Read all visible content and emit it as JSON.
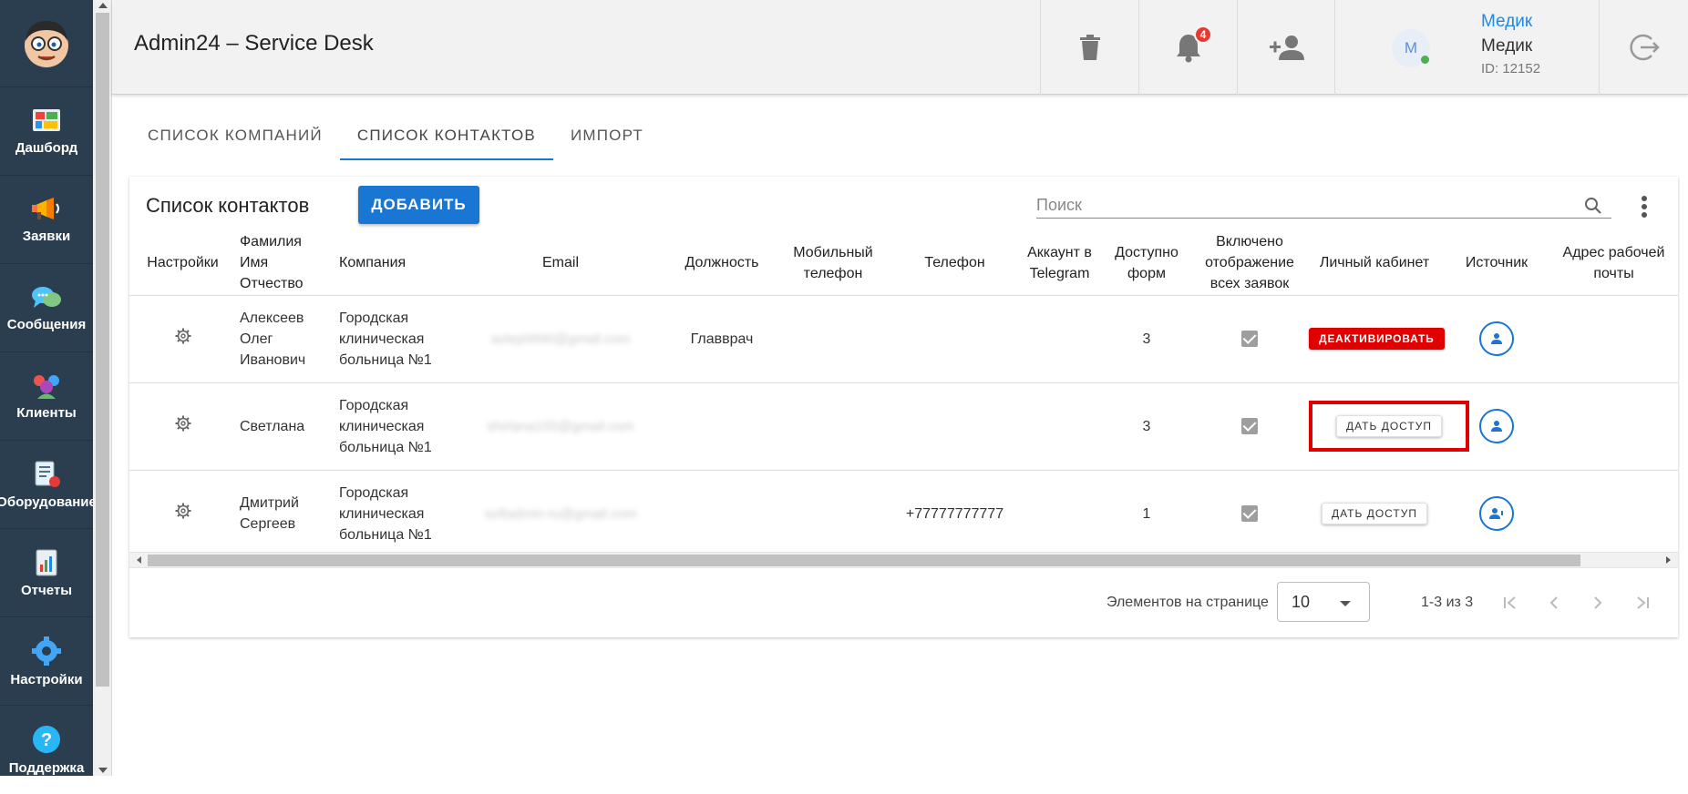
{
  "app": {
    "title": "Admin24 – Service Desk"
  },
  "sidebar": {
    "items": [
      {
        "label": "Дашборд",
        "icon": "dashboard-icon"
      },
      {
        "label": "Заявки",
        "icon": "megaphone-icon"
      },
      {
        "label": "Сообщения",
        "icon": "chat-icon"
      },
      {
        "label": "Клиенты",
        "icon": "clients-icon"
      },
      {
        "label": "Оборудование",
        "icon": "equipment-icon"
      },
      {
        "label": "Отчеты",
        "icon": "reports-icon"
      },
      {
        "label": "Настройки",
        "icon": "gear-icon"
      },
      {
        "label": "Поддержка",
        "icon": "help-icon"
      }
    ]
  },
  "header": {
    "notifications_count": "4",
    "user": {
      "avatar_letter": "M",
      "link_name": "Медик",
      "name": "Медик",
      "id": "ID: 12152"
    }
  },
  "tabs": [
    {
      "label": "СПИСОК КОМПАНИЙ",
      "active": false
    },
    {
      "label": "СПИСОК КОНТАКТОВ",
      "active": true
    },
    {
      "label": "ИМПОРТ",
      "active": false
    }
  ],
  "card": {
    "title": "Список контактов",
    "add_label": "ДОБАВИТЬ",
    "search_placeholder": "Поиск"
  },
  "table": {
    "columns": [
      "Настройки",
      "Фамилия Имя Отчество",
      "Компания",
      "Email",
      "Должность",
      "Мобильный телефон",
      "Телефон",
      "Аккаунт в Telegram",
      "Доступно форм",
      "Включено отображение всех заявок",
      "Личный кабинет",
      "Источник",
      "Адрес рабочей почты"
    ],
    "rows": [
      {
        "name": "Алексеев Олег Иванович",
        "company": "Городская клиническая больница №1",
        "email": "avlep0990@gmail.com",
        "position": "Главврач",
        "mobile": "",
        "phone": "",
        "telegram": "",
        "forms": "3",
        "show_all": true,
        "cabinet_label": "ДЕАКТИВИРОВАТЬ",
        "cabinet_type": "deactivate"
      },
      {
        "name": "Светлана",
        "company": "Городская клиническая больница №1",
        "email": "shirlana155@gmail.com",
        "position": "",
        "mobile": "",
        "phone": "",
        "telegram": "",
        "forms": "3",
        "show_all": true,
        "cabinet_label": "ДАТЬ ДОСТУП",
        "cabinet_type": "grant-highlighted"
      },
      {
        "name": "Дмитрий Сергеев",
        "company": "Городская клиническая больница №1",
        "email": "softadmin-ru@gmail.com",
        "position": "",
        "mobile": "",
        "phone": "+77777777777",
        "telegram": "",
        "forms": "1",
        "show_all": true,
        "cabinet_label": "ДАТЬ ДОСТУП",
        "cabinet_type": "grant"
      }
    ]
  },
  "paginator": {
    "per_page_label": "Элементов на странице",
    "per_page_value": "10",
    "range_label": "1-3 из 3"
  },
  "colors": {
    "sidebar": "#2b3e50",
    "primary": "#1976d2",
    "danger": "#e00000",
    "badge": "#e53935"
  }
}
